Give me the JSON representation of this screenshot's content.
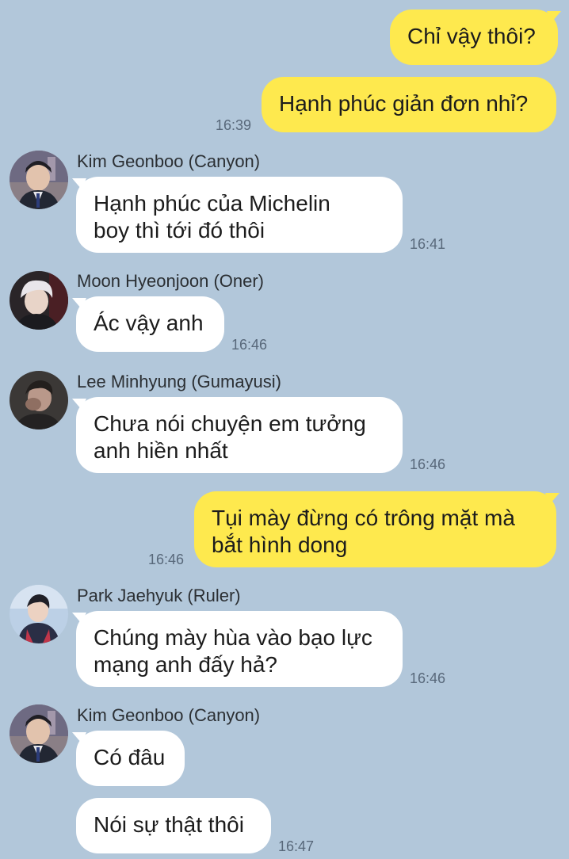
{
  "colors": {
    "background": "#b2c7da",
    "my_bubble": "#fee94e",
    "their_bubble": "#ffffff"
  },
  "messages": [
    {
      "sender": "me",
      "text": "Chỉ vậy thôi?"
    },
    {
      "sender": "me",
      "text": "Hạnh phúc giản đơn nhỉ?",
      "time": "16:39"
    },
    {
      "sender": "Kim Geonboo (Canyon)",
      "lines": [
        "Hạnh phúc của Michelin",
        "boy thì tới đó thôi"
      ],
      "time": "16:41"
    },
    {
      "sender": "Moon Hyeonjoon (Oner)",
      "text": "Ác vậy anh",
      "time": "16:46"
    },
    {
      "sender": "Lee Minhyung (Gumayusi)",
      "lines": [
        "Chưa nói chuyện em tưởng",
        "anh hiền nhất"
      ],
      "time": "16:46"
    },
    {
      "sender": "me",
      "lines": [
        "Tụi mày đừng có trông mặt mà",
        "bắt hình dong"
      ],
      "time": "16:46"
    },
    {
      "sender": "Park Jaehyuk (Ruler)",
      "lines": [
        "Chúng mày hùa vào bạo lực",
        "mạng anh đấy hả?"
      ],
      "time": "16:46"
    },
    {
      "sender": "Kim Geonboo (Canyon)",
      "text": "Có đâu"
    },
    {
      "sender": "Kim Geonboo (Canyon)",
      "text": "Nói sự thật thôi",
      "time": "16:47"
    }
  ]
}
